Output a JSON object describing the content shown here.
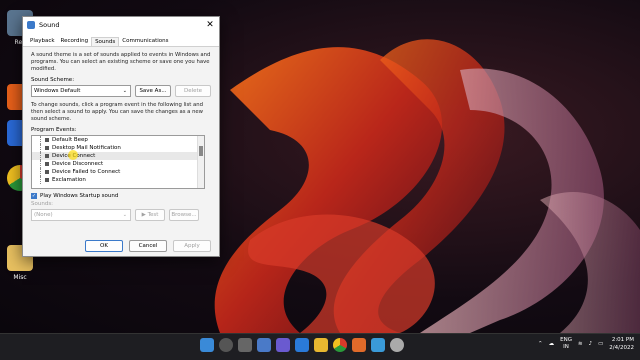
{
  "desktop": {
    "icons": [
      {
        "label": "Rec"
      },
      {
        "label": "Misc"
      }
    ]
  },
  "dialog": {
    "title": "Sound",
    "tabs": [
      {
        "label": "Playback"
      },
      {
        "label": "Recording"
      },
      {
        "label": "Sounds"
      },
      {
        "label": "Communications"
      }
    ],
    "description": "A sound theme is a set of sounds applied to events in Windows and programs. You can select an existing scheme or save one you have modified.",
    "scheme_label": "Sound Scheme:",
    "scheme_value": "Windows Default",
    "save_as": "Save As...",
    "delete": "Delete",
    "instructions": "To change sounds, click a program event in the following list and then select a sound to apply. You can save the changes as a new sound scheme.",
    "events_label": "Program Events:",
    "events": [
      "Default Beep",
      "Desktop Mail Notification",
      "Device Connect",
      "Device Disconnect",
      "Device Failed to Connect",
      "Exclamation"
    ],
    "startup_checkbox": "Play Windows Startup sound",
    "sounds_label": "Sounds:",
    "sounds_value": "(None)",
    "test": "Test",
    "browse": "Browse...",
    "ok": "OK",
    "cancel": "Cancel",
    "apply": "Apply"
  },
  "taskbar": {
    "lang1": "ENG",
    "lang2": "IN",
    "time": "2:01 PM",
    "date": "2/4/2022"
  }
}
